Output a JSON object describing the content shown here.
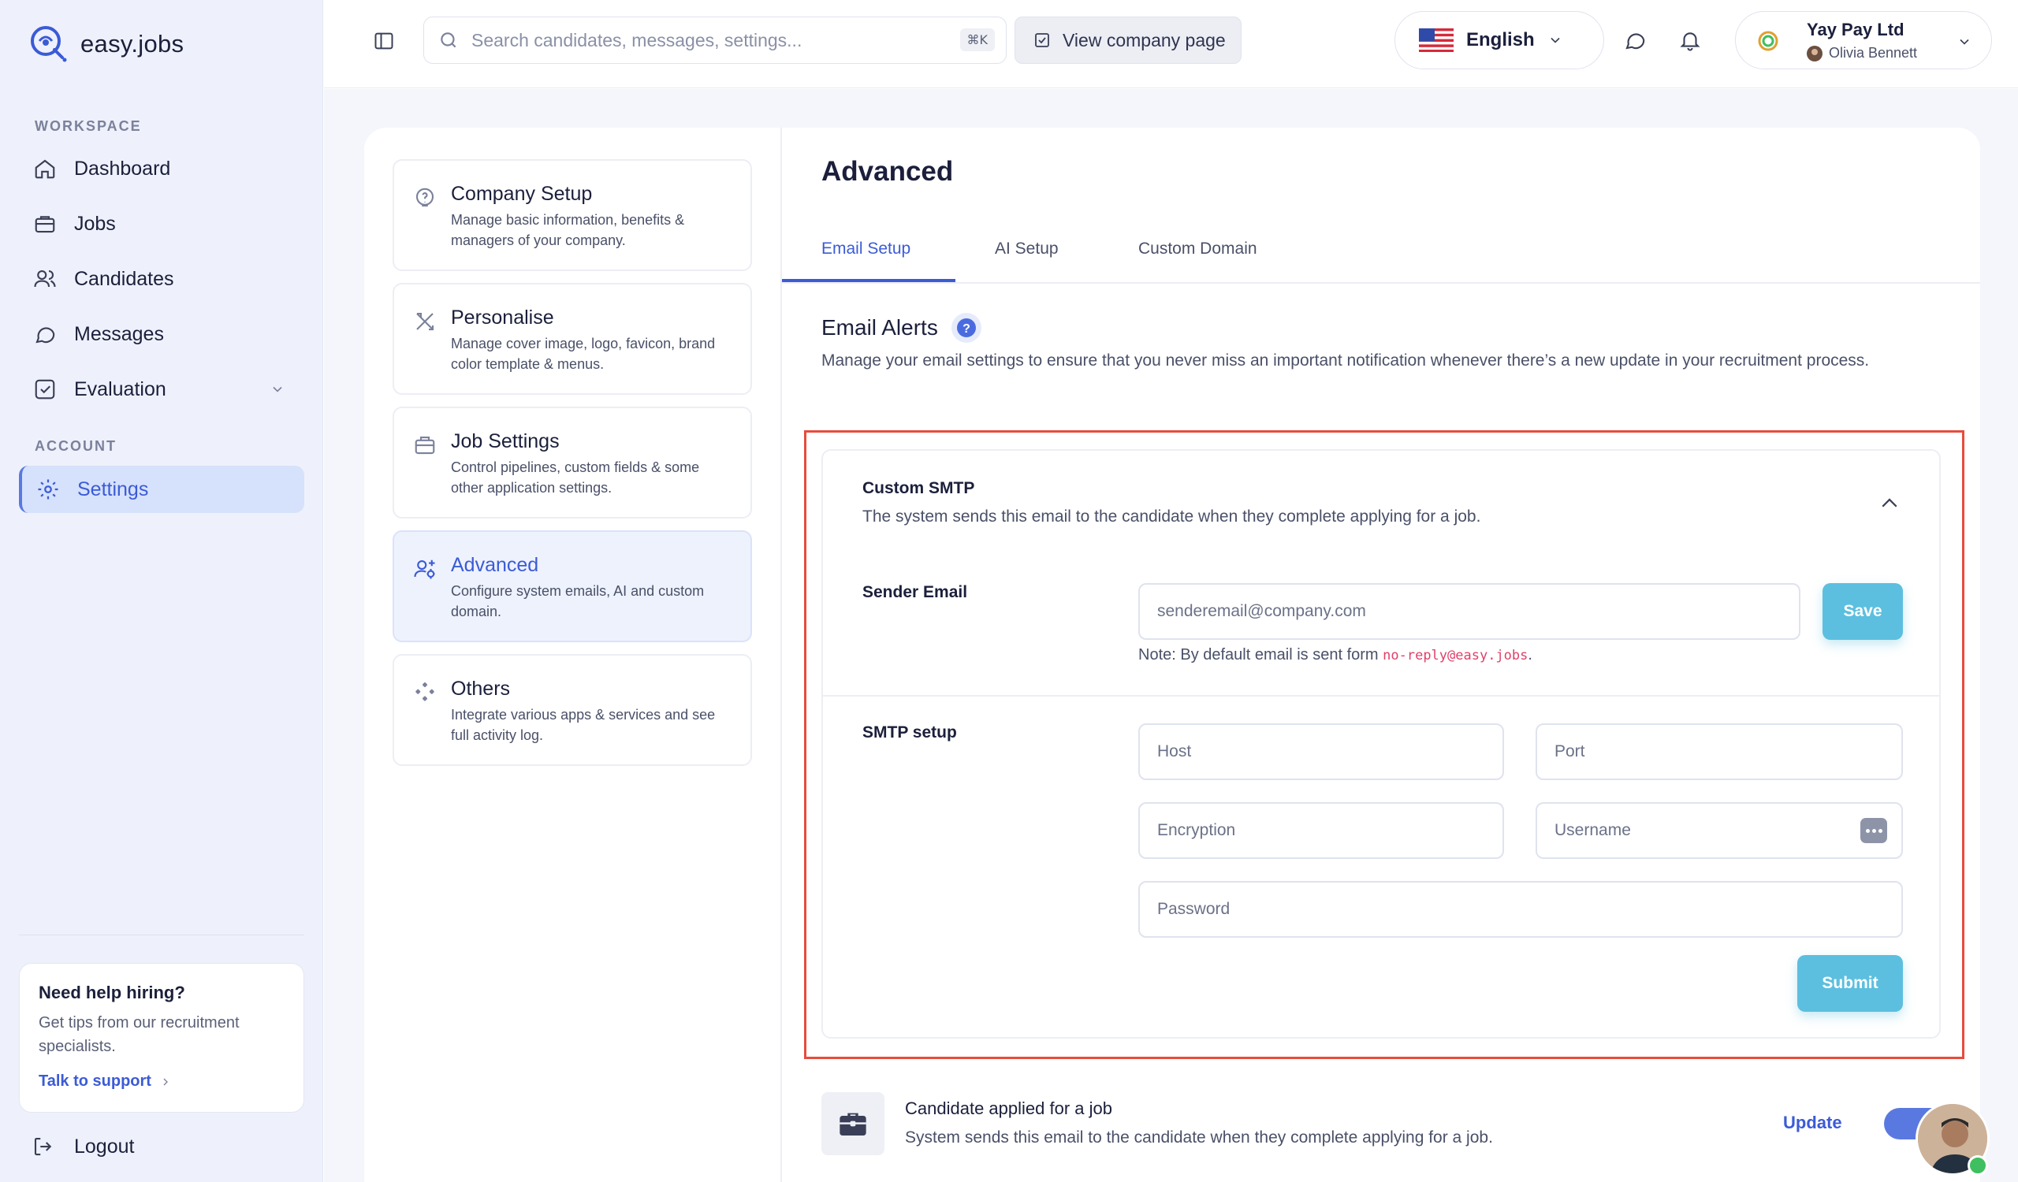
{
  "app": {
    "name": "easy.jobs"
  },
  "sidebar": {
    "workspace_label": "WORKSPACE",
    "account_label": "ACCOUNT",
    "items": [
      {
        "label": "Dashboard",
        "icon": "home-icon"
      },
      {
        "label": "Jobs",
        "icon": "briefcase-icon"
      },
      {
        "label": "Candidates",
        "icon": "users-icon"
      },
      {
        "label": "Messages",
        "icon": "chat-icon"
      },
      {
        "label": "Evaluation",
        "icon": "checkbox-icon"
      }
    ],
    "settings_label": "Settings",
    "help": {
      "title": "Need help hiring?",
      "text": "Get tips from our recruitment specialists.",
      "link": "Talk to support"
    },
    "logout": "Logout"
  },
  "topbar": {
    "search_placeholder": "Search candidates, messages, settings...",
    "shortcut": "⌘K",
    "view_company": "View company page",
    "language": "English",
    "company_name": "Yay Pay Ltd",
    "user_name": "Olivia Bennett"
  },
  "settings_menu": [
    {
      "title": "Company Setup",
      "desc": "Manage basic information, benefits & managers of your company.",
      "icon": "help-circle-icon"
    },
    {
      "title": "Personalise",
      "desc": "Manage cover image, logo, favicon, brand color template & menus.",
      "icon": "tools-icon"
    },
    {
      "title": "Job Settings",
      "desc": "Control pipelines, custom fields & some other application settings.",
      "icon": "briefcase-icon"
    },
    {
      "title": "Advanced",
      "desc": "Configure system emails, AI and custom domain.",
      "icon": "user-gear-icon"
    },
    {
      "title": "Others",
      "desc": "Integrate various apps & services and see full activity log.",
      "icon": "apps-icon"
    }
  ],
  "main": {
    "title": "Advanced",
    "tabs": [
      "Email Setup",
      "AI Setup",
      "Custom Domain"
    ],
    "email_alerts": {
      "title": "Email Alerts",
      "desc": "Manage your email settings to ensure that you never miss an important notification whenever there’s a new update in your recruitment process."
    },
    "smtp": {
      "title": "Custom SMTP",
      "desc": "The system sends this email to the candidate when they complete applying for a job.",
      "sender_label": "Sender Email",
      "sender_placeholder": "senderemail@company.com",
      "save": "Save",
      "note_prefix": "Note: By default email is sent form ",
      "note_email": "no-reply@easy.jobs",
      "note_suffix": ".",
      "setup_label": "SMTP setup",
      "host": "Host",
      "port": "Port",
      "encryption": "Encryption",
      "username": "Username",
      "password": "Password",
      "submit": "Submit"
    },
    "candidate_applied": {
      "title": "Candidate applied for a job",
      "desc": "System sends this email to the candidate when they complete applying for a job.",
      "update": "Update",
      "toggle_on": true
    }
  },
  "colors": {
    "accent": "#3b5bd6",
    "button": "#5cbfdf",
    "highlight": "#e74c3c"
  }
}
